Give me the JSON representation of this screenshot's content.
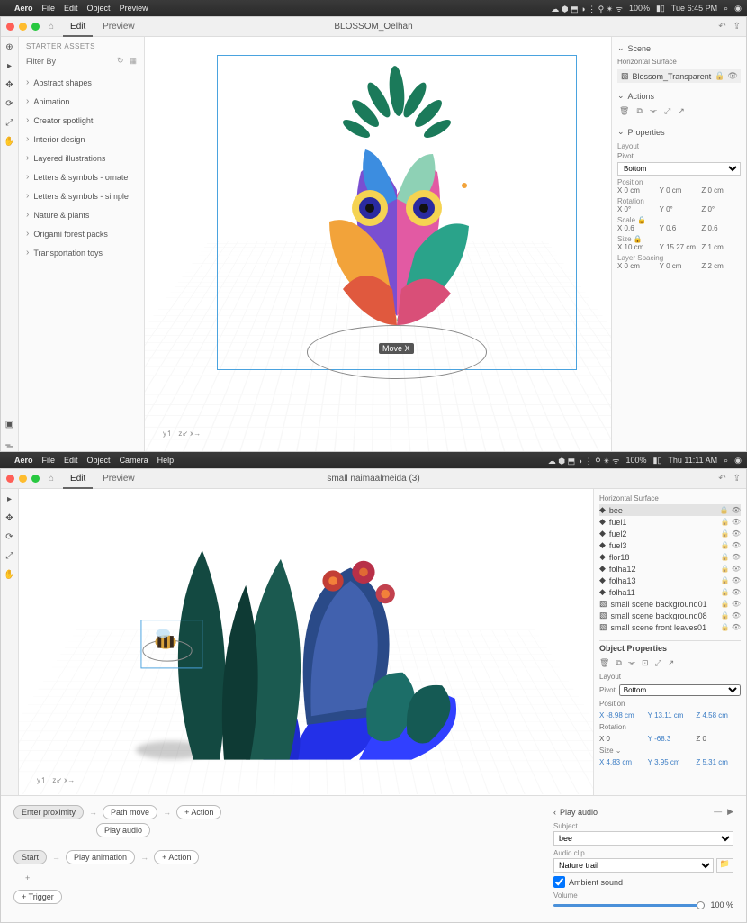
{
  "top": {
    "menubar": {
      "app": "Aero",
      "items": [
        "File",
        "Edit",
        "Object",
        "Preview"
      ],
      "time": "Tue 6:45 PM",
      "battery": "100%"
    },
    "titlebar": {
      "tabs": [
        "Edit",
        "Preview"
      ],
      "active": 0,
      "doc": "BLOSSOM_Oelhan"
    },
    "left": {
      "header": "STARTER ASSETS",
      "filter_label": "Filter By",
      "categories": [
        "Abstract shapes",
        "Animation",
        "Creator spotlight",
        "Interior design",
        "Layered illustrations",
        "Letters & symbols - ornate",
        "Letters & symbols - simple",
        "Nature & plants",
        "Origami forest packs",
        "Transportation toys"
      ]
    },
    "canvas": {
      "gizmo_label": "Move X"
    },
    "right": {
      "scene_label": "Scene",
      "anchor_label": "Horizontal Surface",
      "scene_item": "Blossom_Transparent",
      "actions_label": "Actions",
      "properties_label": "Properties",
      "layout_label": "Layout",
      "pivot_label": "Pivot",
      "pivot_value": "Bottom",
      "position_label": "Position",
      "position": {
        "x": "X  0 cm",
        "y": "Y  0 cm",
        "z": "Z  0 cm"
      },
      "rotation_label": "Rotation",
      "rotation": {
        "x": "X  0°",
        "y": "Y  0°",
        "z": "Z  0°"
      },
      "scale_label": "Scale",
      "scale": {
        "x": "X  0.6",
        "y": "Y  0.6",
        "z": "Z  0.6"
      },
      "size_label": "Size",
      "size": {
        "x": "X  10 cm",
        "y": "Y  15.27 cm",
        "z": "Z  1 cm"
      },
      "layerspacing_label": "Layer Spacing",
      "layerspacing": {
        "x": "X  0 cm",
        "y": "Y  0 cm",
        "z": "Z  2 cm"
      }
    }
  },
  "bottom": {
    "menubar": {
      "app": "Aero",
      "items": [
        "File",
        "Edit",
        "Object",
        "Camera",
        "Help"
      ],
      "time": "Thu 11:11 AM",
      "battery": "100%"
    },
    "titlebar": {
      "tabs": [
        "Edit",
        "Preview"
      ],
      "active": 0,
      "doc": "small naimaalmeida (3)"
    },
    "scene": {
      "anchor_label": "Horizontal Surface",
      "items": [
        "bee",
        "fuel1",
        "fuel2",
        "fuel3",
        "flor18",
        "folha12",
        "folha13",
        "folha11",
        "small scene background01",
        "small scene background08",
        "small scene front leaves01"
      ]
    },
    "props": {
      "header": "Object Properties",
      "layout_label": "Layout",
      "pivot_label": "Pivot",
      "pivot_value": "Bottom",
      "position_label": "Position",
      "position": {
        "x": "X  -8.98 cm",
        "y": "Y  13.11 cm",
        "z": "Z  4.58 cm"
      },
      "rotation_label": "Rotation",
      "rotation": {
        "x": "X  0",
        "y": "Y  -68.3",
        "z": "Z  0"
      },
      "size_label": "Size",
      "size": {
        "x": "X  4.83 cm",
        "y": "Y  3.95 cm",
        "z": "Z  5.31 cm"
      }
    },
    "behaviors": {
      "chain1": {
        "trigger": "Enter proximity",
        "actions": [
          "Path move",
          "Play audio"
        ],
        "add": "+ Action"
      },
      "chain2": {
        "trigger": "Start",
        "actions": [
          "Play animation"
        ],
        "add": "+ Action"
      },
      "add_trigger": "+ Trigger"
    },
    "action_panel": {
      "title": "Play audio",
      "subject_label": "Subject",
      "subject_value": "bee",
      "clip_label": "Audio clip",
      "clip_value": "Nature trail",
      "ambient_label": "Ambient sound",
      "ambient_checked": true,
      "volume_label": "Volume",
      "volume_value": "100 %"
    }
  }
}
